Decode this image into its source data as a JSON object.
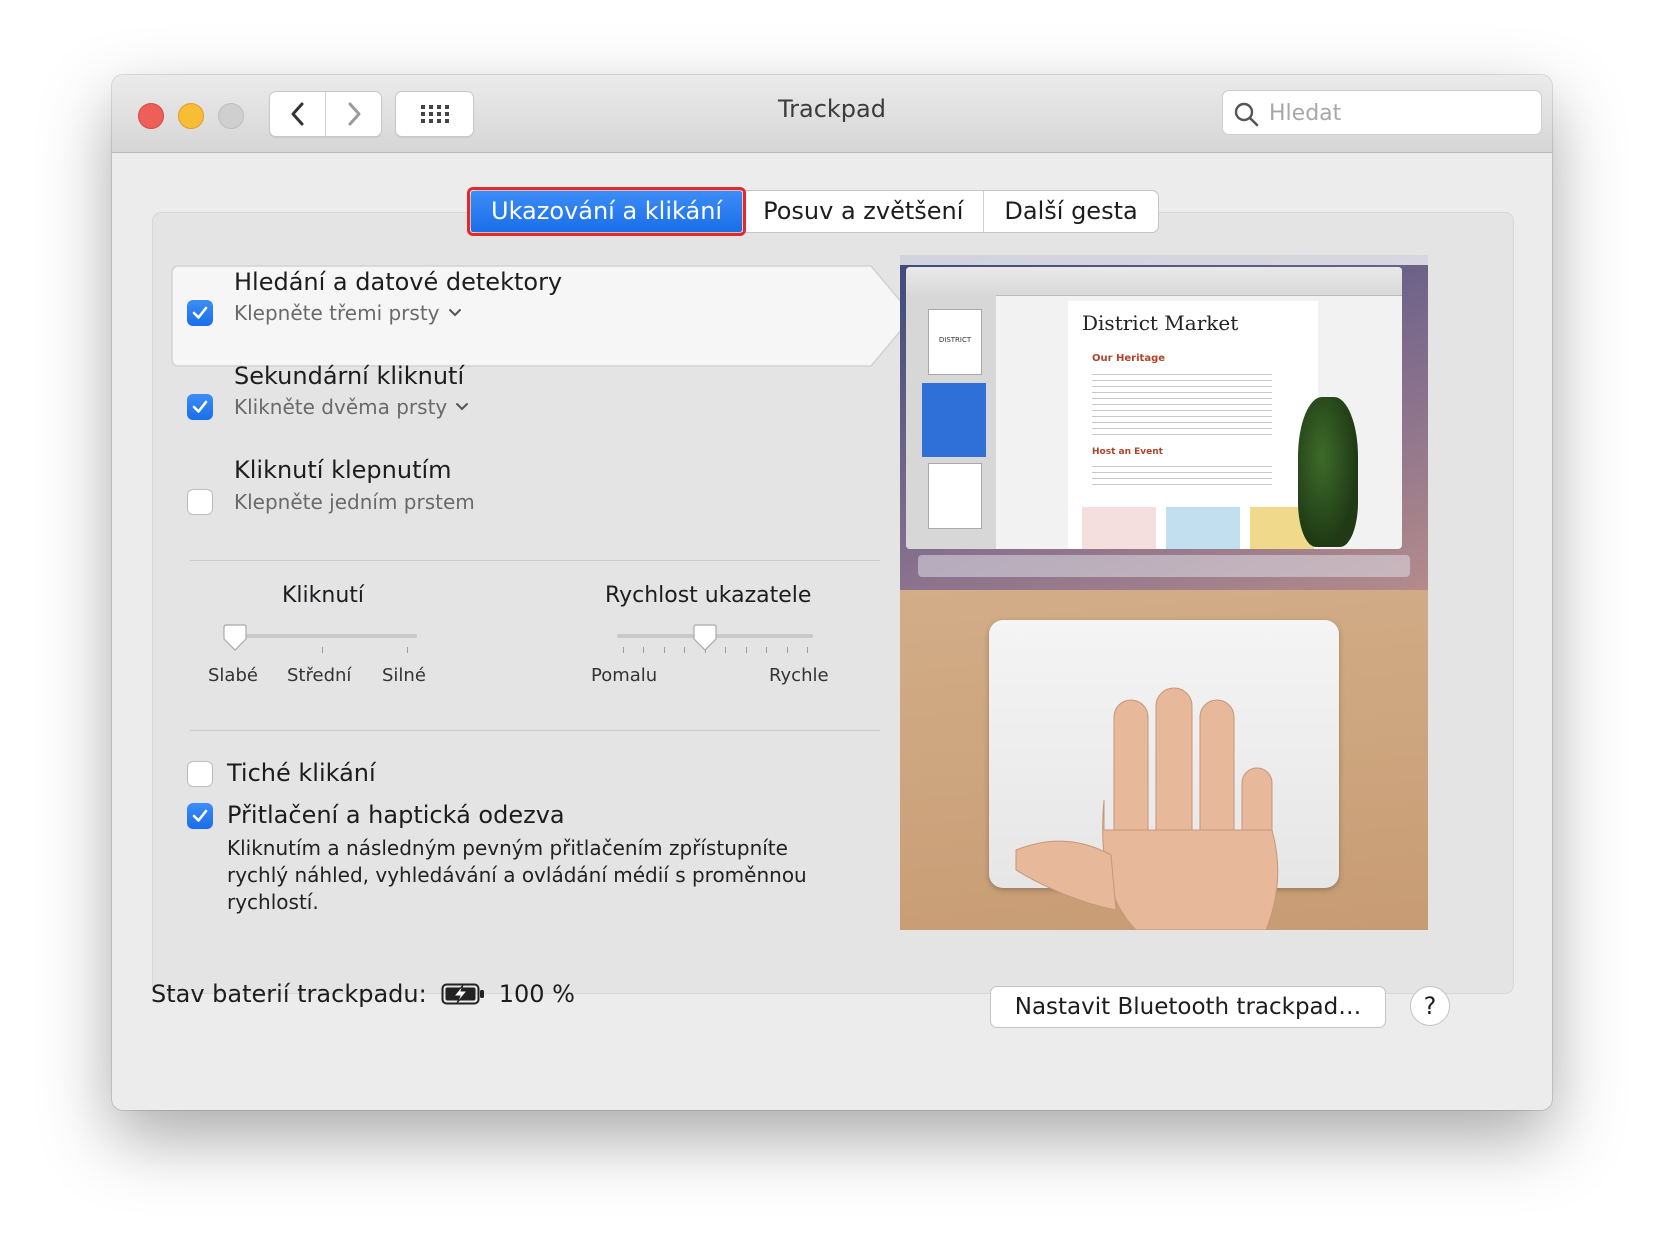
{
  "window": {
    "title": "Trackpad"
  },
  "search": {
    "placeholder": "Hledat"
  },
  "tabs": [
    {
      "label": "Ukazování a klikání"
    },
    {
      "label": "Posuv a zvětšení"
    },
    {
      "label": "Další gesta"
    }
  ],
  "options": [
    {
      "title": "Hledání a datové detektory",
      "subtitle": "Klepněte třemi prsty",
      "checked": true
    },
    {
      "title": "Sekundární kliknutí",
      "subtitle": "Klikněte dvěma prsty",
      "checked": true
    },
    {
      "title": "Kliknutí klepnutím",
      "subtitle": "Klepněte jedním prstem",
      "checked": false
    }
  ],
  "sliders": {
    "click": {
      "title": "Kliknutí",
      "labels": [
        "Slabé",
        "Střední",
        "Silné"
      ],
      "value_index": 0
    },
    "speed": {
      "title": "Rychlost ukazatele",
      "min_label": "Pomalu",
      "max_label": "Rychle",
      "value_fraction": 0.45
    }
  },
  "extras": [
    {
      "title": "Tiché klikání",
      "checked": false
    },
    {
      "title": "Přitlačení a haptická odezva",
      "checked": true,
      "description": "Kliknutím a následným pevným přitlačením zpřístupníte rychlý náhled, vyhledávání a ovládání médií s proměnnou rychlostí."
    }
  ],
  "preview": {
    "app_window_title": "District Market",
    "heading1": "Our Heritage",
    "heading2": "Host an Event",
    "thumbnail_label": "DISTRICT"
  },
  "footer": {
    "battery_label": "Stav baterií trackpadu:",
    "battery_value": "100 %",
    "bluetooth_button": "Nastavit Bluetooth trackpad…",
    "help": "?"
  },
  "colors": {
    "accent": "#1a6ee8",
    "tab_highlight_border": "#e5282b"
  }
}
